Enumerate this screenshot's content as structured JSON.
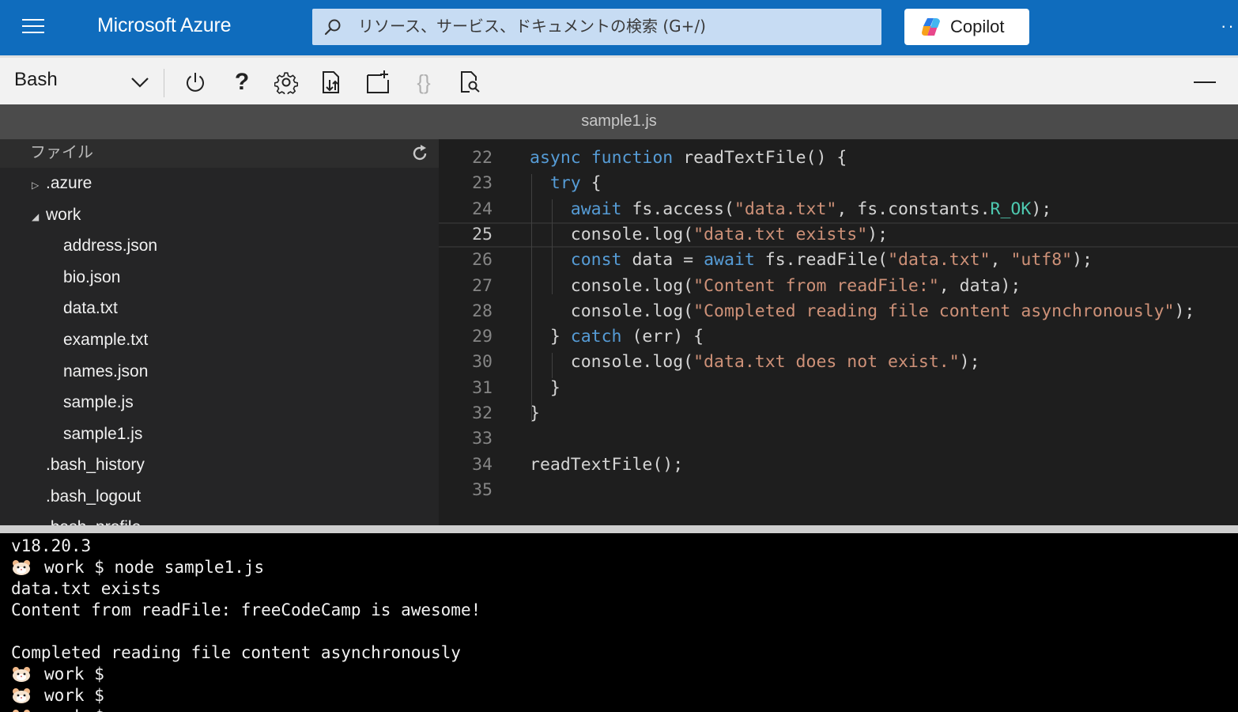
{
  "header": {
    "brand": "Microsoft Azure",
    "search_placeholder": "リソース、サービス、ドキュメントの検索 (G+/)",
    "copilot_label": "Copilot",
    "more_label": "··"
  },
  "toolbar": {
    "shell": "Bash",
    "help_label": "?",
    "braces_label": "{}"
  },
  "editor": {
    "tab_title": "sample1.js",
    "current_line": 25
  },
  "filetree": {
    "header": "ファイル",
    "items": [
      {
        "label": ".azure",
        "expander": "collapsed"
      },
      {
        "label": "work",
        "expander": "expanded"
      },
      {
        "label": "address.json"
      },
      {
        "label": "bio.json"
      },
      {
        "label": "data.txt"
      },
      {
        "label": "example.txt"
      },
      {
        "label": "names.json"
      },
      {
        "label": "sample.js"
      },
      {
        "label": "sample1.js"
      },
      {
        "label": ".bash_history"
      },
      {
        "label": ".bash_logout"
      },
      {
        "label": ".bash_profile"
      }
    ]
  },
  "code": {
    "lines": [
      {
        "num": "22",
        "parts": [
          [
            "k",
            "async"
          ],
          [
            "t",
            " "
          ],
          [
            "k",
            "function"
          ],
          [
            "t",
            " readTextFile() {"
          ]
        ]
      },
      {
        "num": "23",
        "parts": [
          [
            "t",
            "  "
          ],
          [
            "k",
            "try"
          ],
          [
            "t",
            " {"
          ]
        ]
      },
      {
        "num": "24",
        "parts": [
          [
            "t",
            "    "
          ],
          [
            "k",
            "await"
          ],
          [
            "t",
            " fs.access("
          ],
          [
            "s",
            "\"data.txt\""
          ],
          [
            "t",
            ", fs.constants."
          ],
          [
            "c",
            "R_OK"
          ],
          [
            "t",
            ");"
          ]
        ]
      },
      {
        "num": "25",
        "parts": [
          [
            "t",
            "    console.log("
          ],
          [
            "s",
            "\"data.txt exists\""
          ],
          [
            "t",
            ");"
          ]
        ]
      },
      {
        "num": "26",
        "parts": [
          [
            "t",
            "    "
          ],
          [
            "k",
            "const"
          ],
          [
            "t",
            " data = "
          ],
          [
            "k",
            "await"
          ],
          [
            "t",
            " fs.readFile("
          ],
          [
            "s",
            "\"data.txt\""
          ],
          [
            "t",
            ", "
          ],
          [
            "s",
            "\"utf8\""
          ],
          [
            "t",
            ");"
          ]
        ]
      },
      {
        "num": "27",
        "parts": [
          [
            "t",
            "    console.log("
          ],
          [
            "s",
            "\"Content from readFile:\""
          ],
          [
            "t",
            ", data);"
          ]
        ]
      },
      {
        "num": "28",
        "parts": [
          [
            "t",
            "    console.log("
          ],
          [
            "s",
            "\"Completed reading file content asynchronously\""
          ],
          [
            "t",
            ");"
          ]
        ]
      },
      {
        "num": "29",
        "parts": [
          [
            "t",
            "  } "
          ],
          [
            "k",
            "catch"
          ],
          [
            "t",
            " (err) {"
          ]
        ]
      },
      {
        "num": "30",
        "parts": [
          [
            "t",
            "    console.log("
          ],
          [
            "s",
            "\"data.txt does not exist.\""
          ],
          [
            "t",
            ");"
          ]
        ]
      },
      {
        "num": "31",
        "parts": [
          [
            "t",
            "  }"
          ]
        ]
      },
      {
        "num": "32",
        "parts": [
          [
            "t",
            "}"
          ]
        ]
      },
      {
        "num": "33",
        "parts": []
      },
      {
        "num": "34",
        "parts": [
          [
            "t",
            "readTextFile();"
          ]
        ]
      },
      {
        "num": "35",
        "parts": []
      }
    ]
  },
  "terminal": {
    "lines": [
      {
        "text": "v18.20.3"
      },
      {
        "icon": "hamster-icon",
        "text": "work $ node sample1.js"
      },
      {
        "text": "data.txt exists"
      },
      {
        "text": "Content from readFile: freeCodeCamp is awesome!"
      },
      {
        "text": ""
      },
      {
        "text": "Completed reading file content asynchronously"
      },
      {
        "icon": "hamster-icon",
        "text": "work $"
      },
      {
        "icon": "hamster-icon",
        "text": "work $"
      },
      {
        "icon": "hamster-icon",
        "text": "work $"
      }
    ]
  },
  "colors": {
    "azure_blue": "#0f6cbd",
    "keyword": "#569cd6",
    "string": "#ce9178",
    "constant": "#4ec9b0",
    "editor_bg": "#1e1e1e",
    "tree_bg": "#252526"
  }
}
